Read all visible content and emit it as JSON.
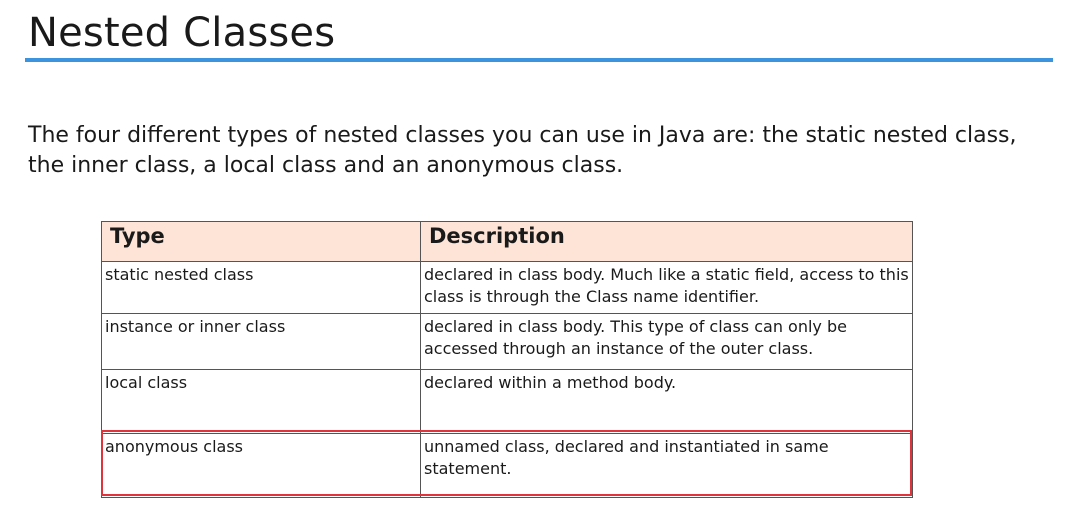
{
  "slide": {
    "title": "Nested Classes",
    "intro": "The four different types of nested classes you can use in Java are: the static nested class, the inner class, a local class and an anonymous class."
  },
  "table": {
    "headers": [
      "Type",
      "Description"
    ],
    "rows": [
      {
        "type": "static nested class",
        "description": "declared in class body.  Much like a static field, access to this class is through the Class name identifier."
      },
      {
        "type": "instance or inner class",
        "description": "declared in class body.  This type of class can only be accessed through an instance of the outer class."
      },
      {
        "type": "local class",
        "description": "declared within a method body."
      },
      {
        "type": "anonymous class",
        "description": "unnamed class, declared and instantiated in same statement."
      }
    ]
  },
  "colors": {
    "accent_underline": "#3d94de",
    "header_fill": "#fde4d6",
    "highlight_border": "#e0343a"
  }
}
